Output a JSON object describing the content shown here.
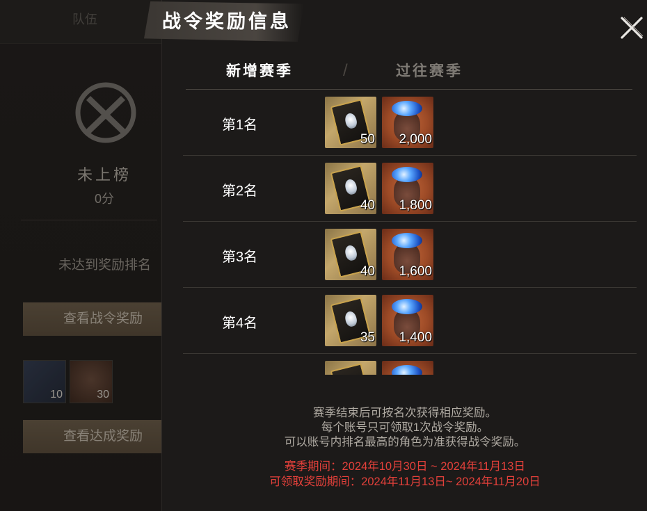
{
  "background_panel": {
    "tab_label": "队伍",
    "rank_status": "未上榜",
    "score": "0分",
    "reward_status": "未达到奖励排名",
    "view_pass_rewards_button": "查看战令奖励",
    "view_achievement_rewards_button": "查看达成奖励",
    "items": [
      {
        "icon": "pass-card-icon",
        "count": "10"
      },
      {
        "icon": "gem-bag-icon",
        "count": "30"
      }
    ]
  },
  "dialog": {
    "title": "战令奖励信息",
    "close_icon": "close-x-icon",
    "tabs": [
      {
        "label": "新增赛季",
        "active": true
      },
      {
        "label": "过往赛季",
        "active": false
      }
    ],
    "tab_separator": "/",
    "rows": [
      {
        "rank": "第1名",
        "rewards": [
          {
            "icon": "pass-card-icon",
            "count": "50"
          },
          {
            "icon": "gem-bag-icon",
            "count": "2,000"
          }
        ]
      },
      {
        "rank": "第2名",
        "rewards": [
          {
            "icon": "pass-card-icon",
            "count": "40"
          },
          {
            "icon": "gem-bag-icon",
            "count": "1,800"
          }
        ]
      },
      {
        "rank": "第3名",
        "rewards": [
          {
            "icon": "pass-card-icon",
            "count": "40"
          },
          {
            "icon": "gem-bag-icon",
            "count": "1,600"
          }
        ]
      },
      {
        "rank": "第4名",
        "rewards": [
          {
            "icon": "pass-card-icon",
            "count": "35"
          },
          {
            "icon": "gem-bag-icon",
            "count": "1,400"
          }
        ]
      },
      {
        "rank": "",
        "rewards": [
          {
            "icon": "pass-card-icon",
            "count": ""
          },
          {
            "icon": "gem-bag-icon",
            "count": ""
          }
        ]
      }
    ],
    "notes": [
      "赛季结束后可按名次获得相应奖励。",
      "每个账号只可领取1次战令奖励。",
      "可以账号内排名最高的角色为准获得战令奖励。"
    ],
    "season_period": "赛季期间：2024年10月30日 ~ 2024年11月13日",
    "claim_period": "可领取奖励期间：2024年11月13日~ 2024年11月20日"
  },
  "colors": {
    "accent_red": "#e2403a",
    "dialog_bg": "#1c1a19",
    "text_white": "#ffffff",
    "text_muted": "#b0aba3"
  }
}
